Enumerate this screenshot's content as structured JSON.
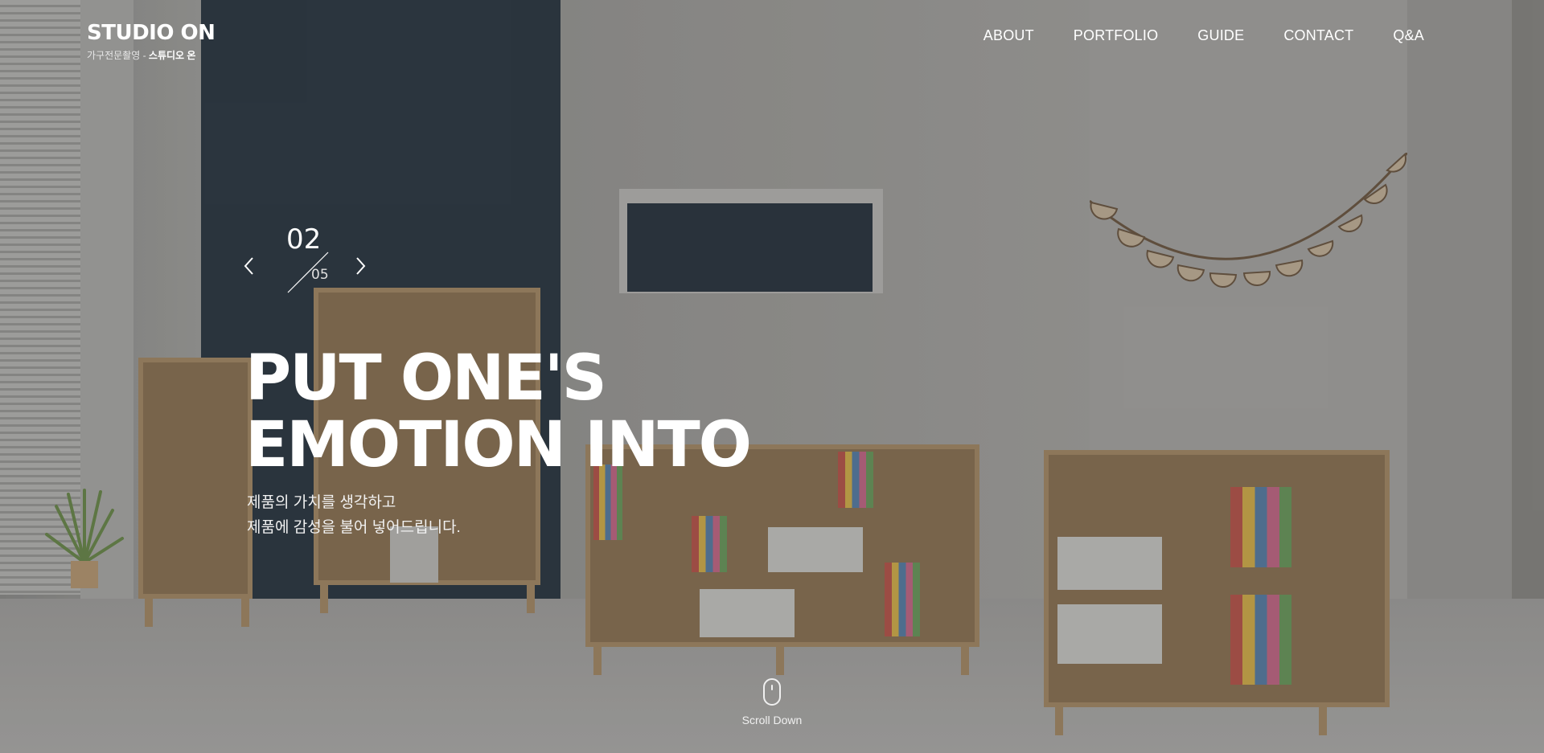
{
  "logo": {
    "text_main": "STUDIO ON",
    "text_sub_light": "가구전문촬영 - ",
    "text_sub_bold": "스튜디오 온"
  },
  "nav": {
    "items": [
      "ABOUT",
      "PORTFOLIO",
      "GUIDE",
      "CONTACT",
      "Q&A"
    ]
  },
  "slider": {
    "current": "02",
    "total": "05",
    "prev_icon": "chevron-left-icon",
    "next_icon": "chevron-right-icon"
  },
  "hero": {
    "headline_line1": "PUT ONE'S",
    "headline_line2": "EMOTION INTO",
    "sub_line1": "제품의 가치를 생각하고",
    "sub_line2": "제품에 감성을 불어 넣어드립니다."
  },
  "scroll": {
    "label": "Scroll Down",
    "icon": "mouse-icon"
  },
  "colors": {
    "text": "#ffffff",
    "accent_wall": "#2e3a45",
    "wood": "#a78c68"
  }
}
